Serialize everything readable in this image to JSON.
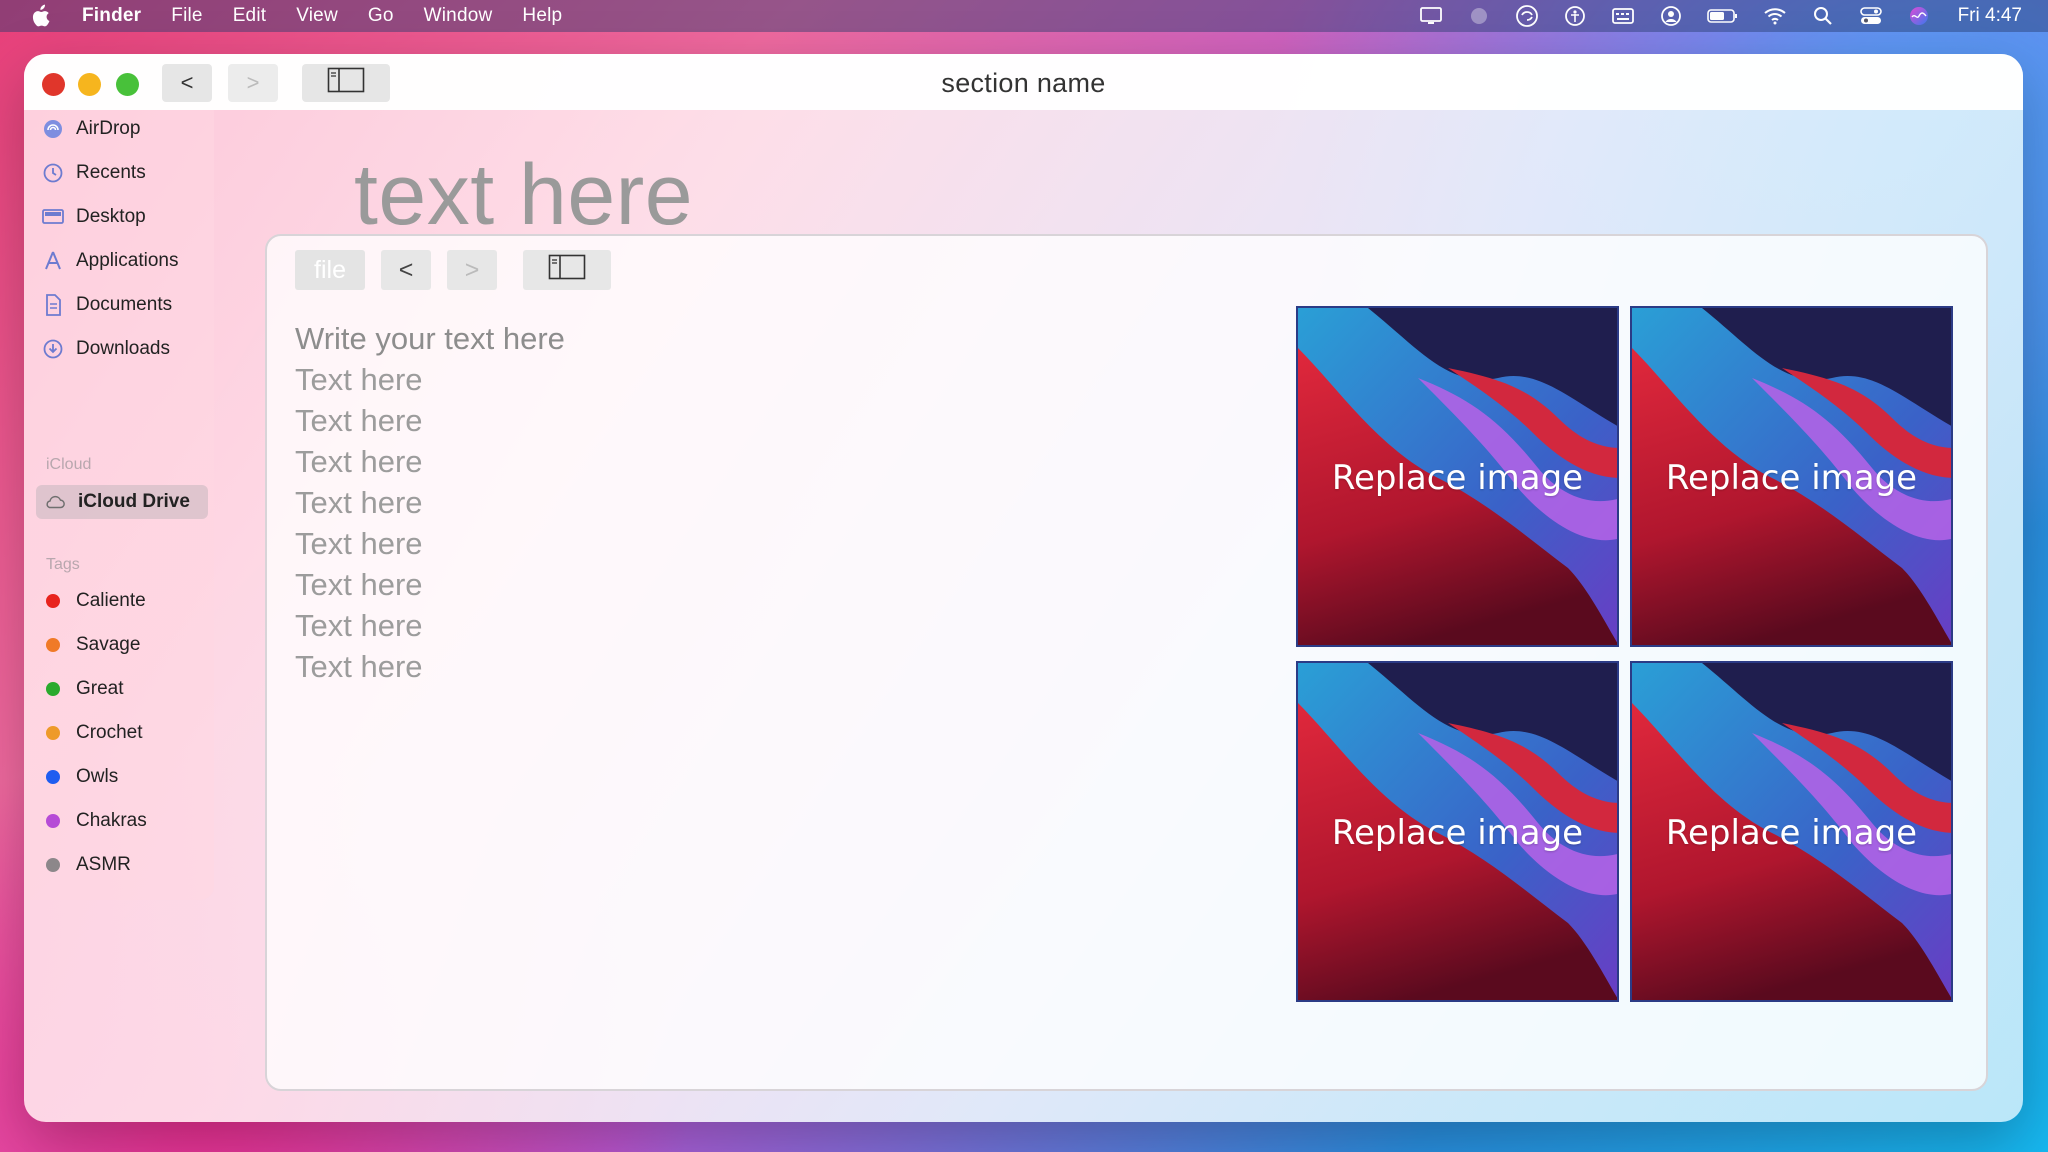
{
  "menubar": {
    "app_name": "Finder",
    "menus": [
      "File",
      "Edit",
      "View",
      "Go",
      "Window",
      "Help"
    ],
    "clock": "Fri 4:47",
    "status_icons": [
      "display-icon",
      "siri-dim-icon",
      "sync-icon",
      "accessibility-icon",
      "keyboard-icon",
      "user-icon",
      "battery-icon",
      "wifi-icon",
      "search-icon",
      "control-center-icon",
      "siri-icon"
    ]
  },
  "window": {
    "title": "section name",
    "back_label": "<",
    "forward_label": ">"
  },
  "sidebar": {
    "favorites": [
      {
        "label": "AirDrop",
        "icon": "airdrop-icon"
      },
      {
        "label": "Recents",
        "icon": "clock-icon"
      },
      {
        "label": "Desktop",
        "icon": "desktop-icon"
      },
      {
        "label": "Applications",
        "icon": "applications-icon"
      },
      {
        "label": "Documents",
        "icon": "document-icon"
      },
      {
        "label": "Downloads",
        "icon": "download-icon"
      }
    ],
    "icloud_header": "iCloud",
    "icloud_items": [
      {
        "label": "iCloud Drive",
        "icon": "cloud-icon",
        "selected": true
      }
    ],
    "tags_header": "Tags",
    "tags": [
      {
        "label": "Caliente",
        "color": "#e8231d"
      },
      {
        "label": "Savage",
        "color": "#f07a27"
      },
      {
        "label": "Great",
        "color": "#2aaa2d"
      },
      {
        "label": "Crochet",
        "color": "#ee9a2a"
      },
      {
        "label": "Owls",
        "color": "#1f5df0"
      },
      {
        "label": "Chakras",
        "color": "#b64bd6"
      },
      {
        "label": "ASMR",
        "color": "#8c878a"
      }
    ]
  },
  "main": {
    "heading": "text here",
    "toolbar": {
      "file_label": "file",
      "back_label": "<",
      "forward_label": ">"
    },
    "text_lines": [
      "Write your text here",
      "Text here",
      "Text here",
      "Text here",
      "Text here",
      "Text here",
      "Text here",
      "Text here",
      "Text here"
    ],
    "images": [
      {
        "label": "Replace image"
      },
      {
        "label": "Replace image"
      },
      {
        "label": "Replace image"
      },
      {
        "label": "Replace image"
      }
    ]
  }
}
